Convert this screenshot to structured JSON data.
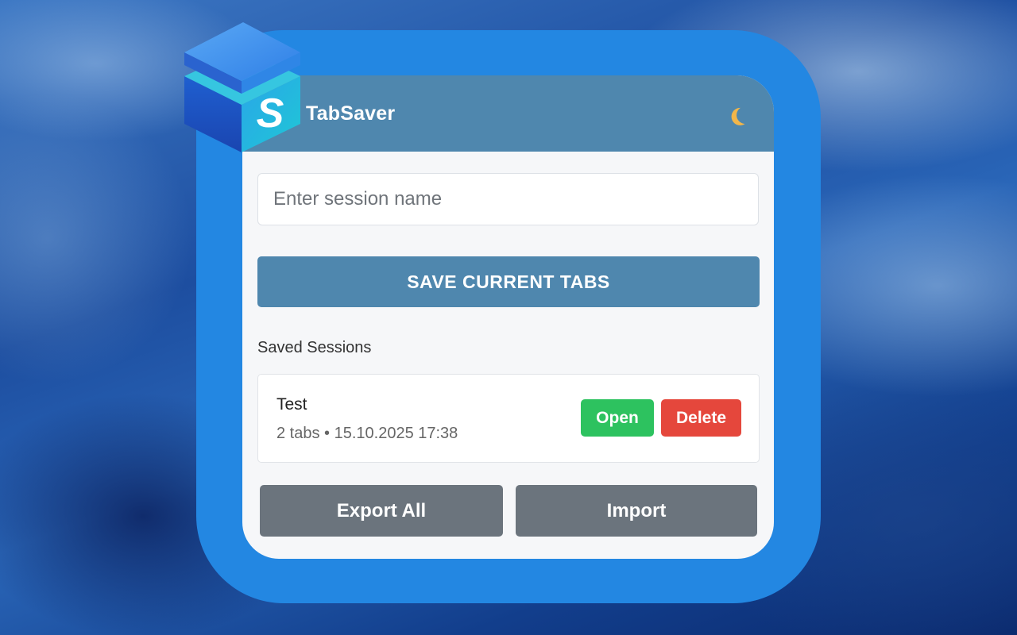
{
  "app": {
    "title": "TabSaver",
    "logo_letter": "S",
    "theme_icon": "moon-icon"
  },
  "form": {
    "session_name_placeholder": "Enter session name",
    "session_name_value": "",
    "save_label": "SAVE CURRENT TABS"
  },
  "sessions": {
    "label": "Saved Sessions",
    "items": [
      {
        "name": "Test",
        "meta": "2 tabs • 15.10.2025 17:38",
        "open_label": "Open",
        "delete_label": "Delete"
      }
    ]
  },
  "footer": {
    "export_label": "Export All",
    "import_label": "Import"
  },
  "colors": {
    "header": "#4f87ae",
    "frame": "#2387e2",
    "open": "#2dc25f",
    "delete": "#e5473c",
    "secondary": "#6b747d"
  }
}
